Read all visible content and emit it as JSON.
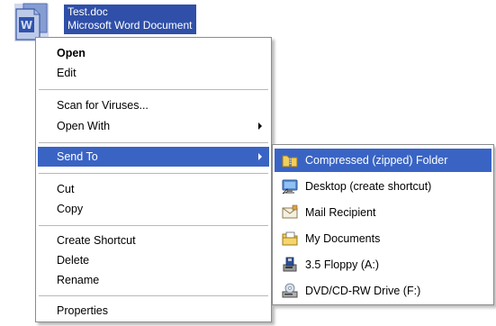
{
  "file": {
    "name": "Test.doc",
    "type": "Microsoft Word Document",
    "icon": "word-document-icon"
  },
  "context_menu": {
    "items": [
      {
        "label": "Open",
        "bold": true
      },
      {
        "label": "Edit"
      },
      {
        "label": "Scan for Viruses..."
      },
      {
        "label": "Open With",
        "submenu": true
      },
      {
        "label": "Send To",
        "submenu": true,
        "selected": true
      },
      {
        "label": "Cut"
      },
      {
        "label": "Copy"
      },
      {
        "label": "Create Shortcut"
      },
      {
        "label": "Delete"
      },
      {
        "label": "Rename"
      },
      {
        "label": "Properties"
      }
    ]
  },
  "send_to_menu": {
    "items": [
      {
        "label": "Compressed (zipped) Folder",
        "icon": "zip-folder-icon",
        "selected": true
      },
      {
        "label": "Desktop (create shortcut)",
        "icon": "desktop-icon"
      },
      {
        "label": "Mail Recipient",
        "icon": "mail-icon"
      },
      {
        "label": "My Documents",
        "icon": "my-documents-icon"
      },
      {
        "label": "3.5 Floppy (A:)",
        "icon": "floppy-drive-icon"
      },
      {
        "label": "DVD/CD-RW Drive (F:)",
        "icon": "dvd-drive-icon"
      }
    ]
  },
  "colors": {
    "selection": "#3a64c4",
    "file_label_selection": "#2f4fa8",
    "separator": "#b8b8b8",
    "menu_border": "#8c8c8c"
  }
}
